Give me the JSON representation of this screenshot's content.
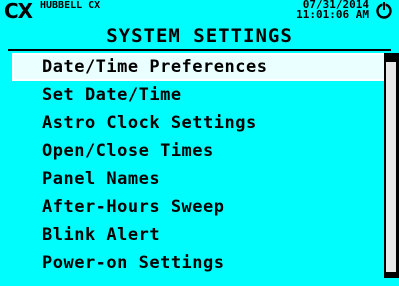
{
  "header": {
    "brand_logo": "CX",
    "device_name": "HUBBELL CX",
    "date": "07/31/2014",
    "time": "11:01:06 AM",
    "power_icon": "power-icon"
  },
  "title": "SYSTEM SETTINGS",
  "menu": {
    "selected_index": 0,
    "items": [
      {
        "label": "Date/Time Preferences"
      },
      {
        "label": "Set Date/Time"
      },
      {
        "label": "Astro Clock Settings"
      },
      {
        "label": "Open/Close Times"
      },
      {
        "label": "Panel Names"
      },
      {
        "label": "After-Hours Sweep"
      },
      {
        "label": "Blink Alert"
      },
      {
        "label": "Power-on Settings"
      }
    ]
  },
  "colors": {
    "background": "#00fdfd",
    "text": "#000000",
    "selection": "#eaffff"
  }
}
